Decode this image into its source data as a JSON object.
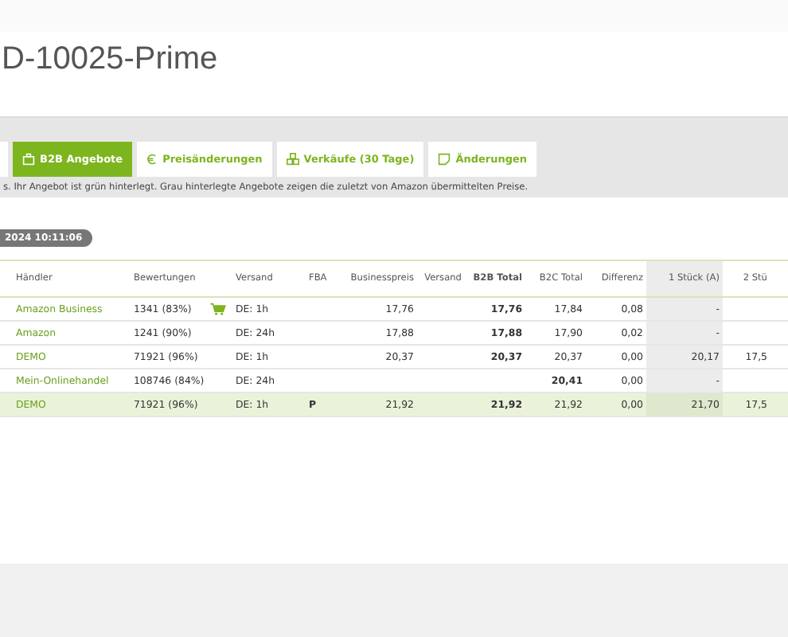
{
  "title": "D-10025-Prime",
  "tabs": [
    {
      "kind": "blank",
      "selected": false
    },
    {
      "label": "B2B Angebote",
      "kind": "briefcase",
      "selected": true
    },
    {
      "label": "Preisänderungen",
      "kind": "euro",
      "selected": false
    },
    {
      "label": "Verkäufe (30 Tage)",
      "kind": "boxes",
      "selected": false
    },
    {
      "label": "Änderungen",
      "kind": "note",
      "selected": false
    }
  ],
  "info_text": "s. Ihr Angebot ist grün hinterlegt. Grau hinterlegte Angebote zeigen die zuletzt von Amazon übermittelten Preise.",
  "timestamp": "2024 10:11:06",
  "table": {
    "columns": [
      "Händler",
      "Bewertungen",
      "",
      "Versand",
      "FBA",
      "Businesspreis",
      "Versand",
      "B2B Total",
      "B2C Total",
      "Differenz",
      "1 Stück (A)",
      "2 Stü"
    ],
    "rows": [
      {
        "seller": "Amazon Business",
        "rating": "1341 (83%)",
        "buy_box": true,
        "shipping": "DE: 1h",
        "fba": "",
        "business_price": "17,76",
        "shipping_cost": "",
        "b2b_total": "17,76",
        "b2c_total": "17,84",
        "b2c_emphasized": false,
        "difference": "0,08",
        "qty_1": "-",
        "qty_2": "",
        "own": false
      },
      {
        "seller": "Amazon",
        "rating": "1241 (90%)",
        "buy_box": false,
        "shipping": "DE: 24h",
        "fba": "",
        "business_price": "17,88",
        "shipping_cost": "",
        "b2b_total": "17,88",
        "b2c_total": "17,90",
        "b2c_emphasized": false,
        "difference": "0,02",
        "qty_1": "-",
        "qty_2": "",
        "own": false
      },
      {
        "seller": "DEMO",
        "rating": "71921 (96%)",
        "buy_box": false,
        "shipping": "DE: 1h",
        "fba": "",
        "business_price": "20,37",
        "shipping_cost": "",
        "b2b_total": "20,37",
        "b2c_total": "20,37",
        "b2c_emphasized": false,
        "difference": "0,00",
        "qty_1": "20,17",
        "qty_2": "17,5",
        "own": false
      },
      {
        "seller": "Mein-Onlinehandel",
        "rating": "108746 (84%)",
        "buy_box": false,
        "shipping": "DE: 24h",
        "fba": "",
        "business_price": "",
        "shipping_cost": "",
        "b2b_total": "",
        "b2c_total": "20,41",
        "b2c_emphasized": true,
        "difference": "0,00",
        "qty_1": "-",
        "qty_2": "",
        "own": false
      },
      {
        "seller": "DEMO",
        "rating": "71921 (96%)",
        "buy_box": false,
        "shipping": "DE: 1h",
        "fba": "P",
        "business_price": "21,92",
        "shipping_cost": "",
        "b2b_total": "21,92",
        "b2c_total": "21,92",
        "b2c_emphasized": false,
        "difference": "0,00",
        "qty_1": "21,70",
        "qty_2": "17,5",
        "own": true
      }
    ]
  }
}
